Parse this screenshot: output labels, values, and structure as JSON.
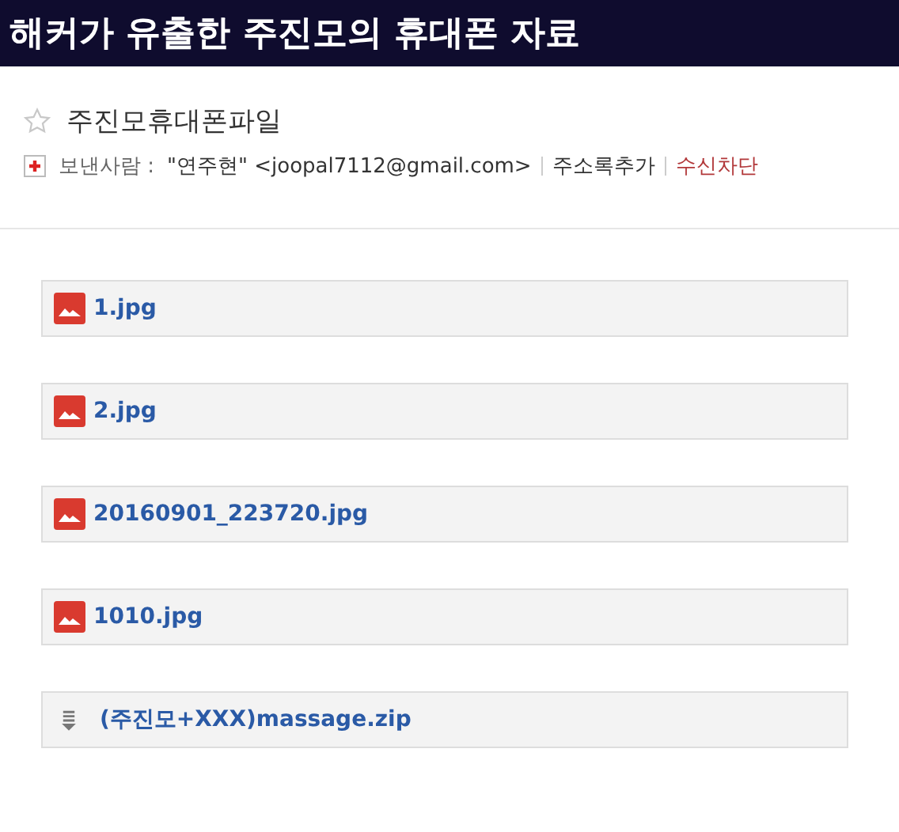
{
  "banner": {
    "headline": "해커가 유출한 주진모의 휴대폰 자료"
  },
  "mail": {
    "subject": "주진모휴대폰파일",
    "starred": false,
    "sender_label": "보낸사람 :",
    "sender": "\"연주현\" <joopal7112@gmail.com>",
    "add_contact": "주소록추가",
    "block": "수신차단"
  },
  "attachments": [
    {
      "kind": "image",
      "name": "1.jpg"
    },
    {
      "kind": "image",
      "name": "2.jpg"
    },
    {
      "kind": "image",
      "name": "20160901_223720.jpg"
    },
    {
      "kind": "image",
      "name": "1010.jpg"
    },
    {
      "kind": "zip",
      "name": "(주진모+XXX)massage.zip"
    }
  ]
}
